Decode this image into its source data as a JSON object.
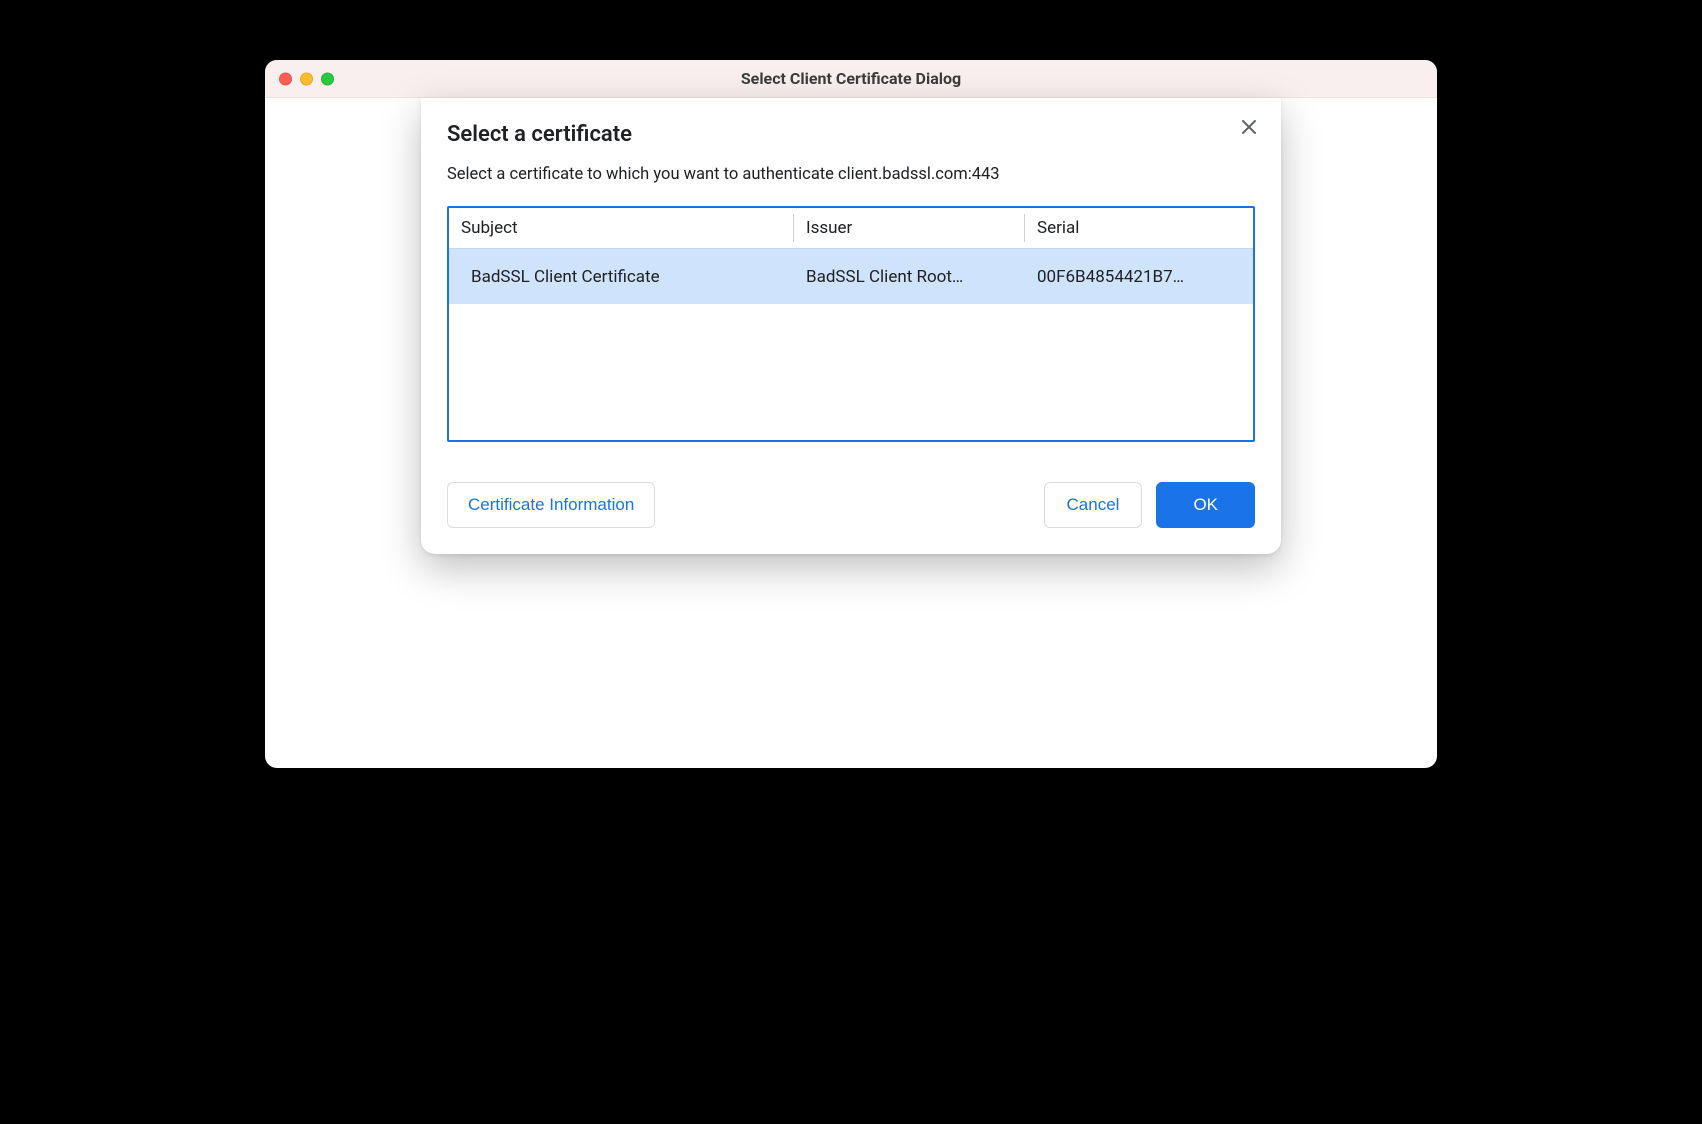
{
  "window": {
    "title": "Select Client Certificate Dialog"
  },
  "dialog": {
    "title": "Select a certificate",
    "subtext": "Select a certificate to which you want to authenticate client.badssl.com:443",
    "columns": {
      "subject": "Subject",
      "issuer": "Issuer",
      "serial": "Serial"
    },
    "rows": [
      {
        "subject": "BadSSL Client Certificate",
        "issuer": "BadSSL Client Root…",
        "serial": "00F6B4854421B7…"
      }
    ],
    "buttons": {
      "cert_info": "Certificate Information",
      "cancel": "Cancel",
      "ok": "OK"
    }
  }
}
